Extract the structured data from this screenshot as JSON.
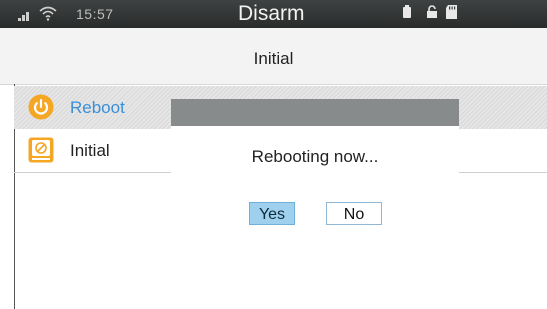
{
  "status_bar": {
    "time": "15:57",
    "mode": "Disarm",
    "icons": [
      "signal-icon",
      "wifi-icon",
      "battery-icon",
      "lock-icon",
      "sd-card-icon"
    ]
  },
  "header": {
    "title": "Initial"
  },
  "menu": {
    "items": [
      {
        "label": "Reboot",
        "icon": "power-icon",
        "selected": true,
        "color": "#3a8fd8"
      },
      {
        "label": "Initial",
        "icon": "reset-icon",
        "selected": false
      }
    ]
  },
  "dialog": {
    "message": "Rebooting now...",
    "yes_label": "Yes",
    "no_label": "No",
    "focused": "Yes"
  },
  "colors": {
    "accent": "#3a8fd8",
    "button_focus": "#9fd1ee",
    "icon_orange": "#f5a623"
  }
}
